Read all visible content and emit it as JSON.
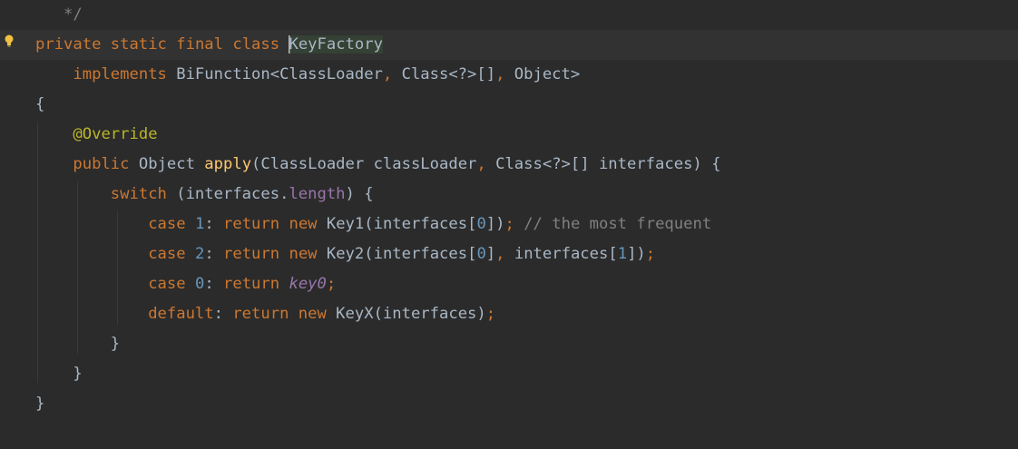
{
  "editor": {
    "accent_colors": {
      "keyword": "#cc7832",
      "method": "#ffc66d",
      "number": "#6897bb",
      "annotation": "#bbb529",
      "field": "#9876aa",
      "comment": "#808080",
      "text": "#a9b7c6",
      "background": "#2b2b2b"
    },
    "gutter_icon": "lightbulb-icon",
    "lines": [
      {
        "tokens": [
          {
            "t": "   */",
            "c": "cmt"
          }
        ]
      },
      {
        "current": true,
        "tokens": [
          {
            "t": "private",
            "c": "kw"
          },
          {
            "t": " ",
            "c": "id"
          },
          {
            "t": "static",
            "c": "kw"
          },
          {
            "t": " ",
            "c": "id"
          },
          {
            "t": "final",
            "c": "kw"
          },
          {
            "t": " ",
            "c": "id"
          },
          {
            "t": "class",
            "c": "kw"
          },
          {
            "t": " ",
            "c": "id"
          },
          {
            "t": "KeyFactory",
            "c": "id sel"
          }
        ]
      },
      {
        "tokens": [
          {
            "t": "    ",
            "c": "id"
          },
          {
            "t": "implements",
            "c": "kw"
          },
          {
            "t": " BiFunction<ClassLoader",
            "c": "id"
          },
          {
            "t": ",",
            "c": "kw"
          },
          {
            "t": " Class<?>[]",
            "c": "id"
          },
          {
            "t": ",",
            "c": "kw"
          },
          {
            "t": " Object>",
            "c": "id"
          }
        ]
      },
      {
        "tokens": [
          {
            "t": "{",
            "c": "id"
          }
        ]
      },
      {
        "tokens": [
          {
            "t": "    ",
            "c": "id"
          },
          {
            "t": "@Override",
            "c": "ann"
          }
        ]
      },
      {
        "tokens": [
          {
            "t": "    ",
            "c": "id"
          },
          {
            "t": "public",
            "c": "kw"
          },
          {
            "t": " Object ",
            "c": "id"
          },
          {
            "t": "apply",
            "c": "fn"
          },
          {
            "t": "(ClassLoader classLoader",
            "c": "id"
          },
          {
            "t": ",",
            "c": "kw"
          },
          {
            "t": " Class<?>[] interfaces) {",
            "c": "id"
          }
        ]
      },
      {
        "tokens": [
          {
            "t": "        ",
            "c": "id"
          },
          {
            "t": "switch",
            "c": "kw"
          },
          {
            "t": " (interfaces.",
            "c": "id"
          },
          {
            "t": "length",
            "c": "field"
          },
          {
            "t": ") {",
            "c": "id"
          }
        ]
      },
      {
        "tokens": [
          {
            "t": "            ",
            "c": "id"
          },
          {
            "t": "case",
            "c": "kw"
          },
          {
            "t": " ",
            "c": "id"
          },
          {
            "t": "1",
            "c": "num"
          },
          {
            "t": ": ",
            "c": "id"
          },
          {
            "t": "return",
            "c": "kw"
          },
          {
            "t": " ",
            "c": "id"
          },
          {
            "t": "new",
            "c": "kw"
          },
          {
            "t": " Key1(interfaces[",
            "c": "id"
          },
          {
            "t": "0",
            "c": "num"
          },
          {
            "t": "])",
            "c": "id"
          },
          {
            "t": ";",
            "c": "kw"
          },
          {
            "t": " // the most frequent",
            "c": "cmt"
          }
        ]
      },
      {
        "tokens": [
          {
            "t": "            ",
            "c": "id"
          },
          {
            "t": "case",
            "c": "kw"
          },
          {
            "t": " ",
            "c": "id"
          },
          {
            "t": "2",
            "c": "num"
          },
          {
            "t": ": ",
            "c": "id"
          },
          {
            "t": "return",
            "c": "kw"
          },
          {
            "t": " ",
            "c": "id"
          },
          {
            "t": "new",
            "c": "kw"
          },
          {
            "t": " Key2(interfaces[",
            "c": "id"
          },
          {
            "t": "0",
            "c": "num"
          },
          {
            "t": "]",
            "c": "id"
          },
          {
            "t": ",",
            "c": "kw"
          },
          {
            "t": " interfaces[",
            "c": "id"
          },
          {
            "t": "1",
            "c": "num"
          },
          {
            "t": "])",
            "c": "id"
          },
          {
            "t": ";",
            "c": "kw"
          }
        ]
      },
      {
        "tokens": [
          {
            "t": "            ",
            "c": "id"
          },
          {
            "t": "case",
            "c": "kw"
          },
          {
            "t": " ",
            "c": "id"
          },
          {
            "t": "0",
            "c": "num"
          },
          {
            "t": ": ",
            "c": "id"
          },
          {
            "t": "return",
            "c": "kw"
          },
          {
            "t": " ",
            "c": "id"
          },
          {
            "t": "key0",
            "c": "static-field"
          },
          {
            "t": ";",
            "c": "kw"
          }
        ]
      },
      {
        "tokens": [
          {
            "t": "            ",
            "c": "id"
          },
          {
            "t": "default",
            "c": "kw"
          },
          {
            "t": ": ",
            "c": "id"
          },
          {
            "t": "return",
            "c": "kw"
          },
          {
            "t": " ",
            "c": "id"
          },
          {
            "t": "new",
            "c": "kw"
          },
          {
            "t": " KeyX(interfaces)",
            "c": "id"
          },
          {
            "t": ";",
            "c": "kw"
          }
        ]
      },
      {
        "tokens": [
          {
            "t": "        }",
            "c": "id"
          }
        ]
      },
      {
        "tokens": [
          {
            "t": "    }",
            "c": "id"
          }
        ]
      },
      {
        "tokens": [
          {
            "t": "}",
            "c": "id"
          }
        ]
      }
    ]
  }
}
